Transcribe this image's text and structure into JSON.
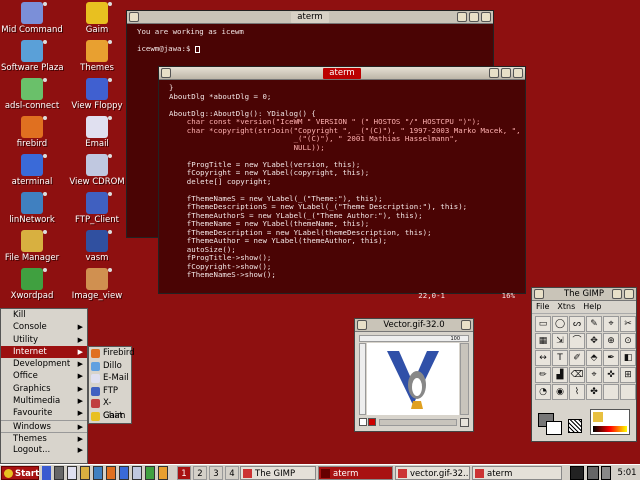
{
  "desktop": {
    "icons_col1": [
      {
        "label": "Mid Command",
        "icon": "gear-icon",
        "color": "#7b8fd8"
      },
      {
        "label": "Software Plaza",
        "icon": "box-icon",
        "color": "#5aa0d8"
      },
      {
        "label": "adsl-connect",
        "icon": "plug-icon",
        "color": "#6ac06a"
      },
      {
        "label": "firebird",
        "icon": "firebird-icon",
        "color": "#e07020"
      },
      {
        "label": "aterminal",
        "icon": "terminal-icon",
        "color": "#3a6ad8"
      },
      {
        "label": "linNetwork",
        "icon": "network-icon",
        "color": "#4080c0"
      },
      {
        "label": "File Manager",
        "icon": "folder-icon",
        "color": "#d8b040"
      },
      {
        "label": "Xwordpad",
        "icon": "document-icon",
        "color": "#40a040"
      }
    ],
    "icons_col2": [
      {
        "label": "Gaim",
        "icon": "gaim-icon",
        "color": "#e8c020"
      },
      {
        "label": "Themes",
        "icon": "palette-icon",
        "color": "#e8a030"
      },
      {
        "label": "View Floppy",
        "icon": "floppy-icon",
        "color": "#4060d0"
      },
      {
        "label": "Email",
        "icon": "mail-icon",
        "color": "#e0e0f0"
      },
      {
        "label": "View CDROM",
        "icon": "cdrom-icon",
        "color": "#c0c8e0"
      },
      {
        "label": "FTP_Client",
        "icon": "ftp-icon",
        "color": "#4060c0"
      },
      {
        "label": "vasm",
        "icon": "monitor-icon",
        "color": "#3050a0"
      },
      {
        "label": "Image_view",
        "icon": "image-icon",
        "color": "#d09050"
      }
    ]
  },
  "term1": {
    "title": "aterm",
    "lines": [
      "You are working as icewm",
      "",
      "icewm@jawa:$ "
    ]
  },
  "term2": {
    "title": "aterm",
    "lines": [
      {
        "t": "}",
        "c": ""
      },
      {
        "t": "AboutDlg *aboutDlg = 0;",
        "c": ""
      },
      {
        "t": "",
        "c": ""
      },
      {
        "t": "AboutDlg::AboutDlg(): YDialog() {",
        "c": ""
      },
      {
        "t": "    char const *version(\"IceWM \" VERSION \" (\" HOSTOS \"/\" HOSTCPU \")\");",
        "c": "cy"
      },
      {
        "t": "    char *copyright(strJoin(\"Copyright \", _(\"(C)\"), \" 1997-2003 Marko Macek, \",",
        "c": "cy"
      },
      {
        "t": "                            _(\"(C)\"), \" 2001 Mathias Hasselmann\",",
        "c": "cy"
      },
      {
        "t": "                            NULL));",
        "c": "cy"
      },
      {
        "t": "",
        "c": ""
      },
      {
        "t": "    fProgTitle = new YLabel(version, this);",
        "c": ""
      },
      {
        "t": "    fCopyright = new YLabel(copyright, this);",
        "c": ""
      },
      {
        "t": "    delete[] copyright;",
        "c": ""
      },
      {
        "t": "",
        "c": ""
      },
      {
        "t": "    fThemeNameS = new YLabel(_(\"Theme:\"), this);",
        "c": ""
      },
      {
        "t": "    fThemeDescriptionS = new YLabel(_(\"Theme Description:\"), this);",
        "c": ""
      },
      {
        "t": "    fThemeAuthorS = new YLabel(_(\"Theme Author:\"), this);",
        "c": ""
      },
      {
        "t": "    fThemeName = new YLabel(themeName, this);",
        "c": ""
      },
      {
        "t": "    fThemeDescription = new YLabel(themeDescription, this);",
        "c": ""
      },
      {
        "t": "    fThemeAuthor = new YLabel(themeAuthor, this);",
        "c": ""
      },
      {
        "t": "    autoSize();",
        "c": ""
      },
      {
        "t": "    fProgTitle->show();",
        "c": ""
      },
      {
        "t": "    fCopyright->show();",
        "c": ""
      },
      {
        "t": "    fThemeNameS->show();",
        "c": ""
      }
    ],
    "status_pos": "22,0-1",
    "status_pct": "16%"
  },
  "gimp": {
    "title": "The GIMP",
    "menus": [
      "File",
      "Xtns",
      "Help"
    ],
    "tools": [
      "▭",
      "◯",
      "ᔕ",
      "✎",
      "⌖",
      "✂",
      "▦",
      "⇲",
      "⌒",
      "✥",
      "⊕",
      "⊙",
      "↔",
      "T",
      "✐",
      "⬘",
      "✒",
      "◧",
      "✏",
      "▟",
      "⌫",
      "⌖",
      "✜",
      "⊞",
      "◔",
      "◉",
      "⌇",
      "✤",
      "",
      "",
      ""
    ]
  },
  "image_window": {
    "title": "Vector.gif-32.0",
    "ruler_mark": "100"
  },
  "start_menu": {
    "items": [
      {
        "label": "Kill",
        "arrow": false
      },
      {
        "label": "Console",
        "arrow": true
      },
      {
        "label": "Utility",
        "arrow": true
      },
      {
        "label": "Internet",
        "arrow": true,
        "selected": true
      },
      {
        "label": "Development",
        "arrow": true
      },
      {
        "label": "Office",
        "arrow": true
      },
      {
        "label": "Graphics",
        "arrow": true
      },
      {
        "label": "Multimedia",
        "arrow": true
      },
      {
        "label": "Favourite",
        "arrow": true
      },
      {
        "label": "Windows",
        "arrow": true,
        "sep": true
      },
      {
        "label": "Themes",
        "arrow": true,
        "sep": true
      },
      {
        "label": "Logout...",
        "arrow": true
      }
    ],
    "internet_submenu": [
      {
        "label": "Firebird",
        "color": "#e07020"
      },
      {
        "label": "Dillo",
        "color": "#60a0e0"
      },
      {
        "label": "E-Mail",
        "color": "#e0e0f0"
      },
      {
        "label": "FTP",
        "color": "#4060c0"
      },
      {
        "label": "X-Chat",
        "color": "#c04040"
      },
      {
        "label": "Gaim",
        "color": "#e8c020"
      }
    ]
  },
  "taskbar": {
    "start_label": "Start",
    "workspaces": [
      "1",
      "2",
      "3",
      "4"
    ],
    "tasks": [
      {
        "label": "The GIMP",
        "active": false
      },
      {
        "label": "aterm",
        "active": true
      },
      {
        "label": "vector.gif-32....",
        "active": false
      },
      {
        "label": "aterm",
        "active": false
      }
    ],
    "clock": "5:01",
    "accent": "#a81212"
  }
}
